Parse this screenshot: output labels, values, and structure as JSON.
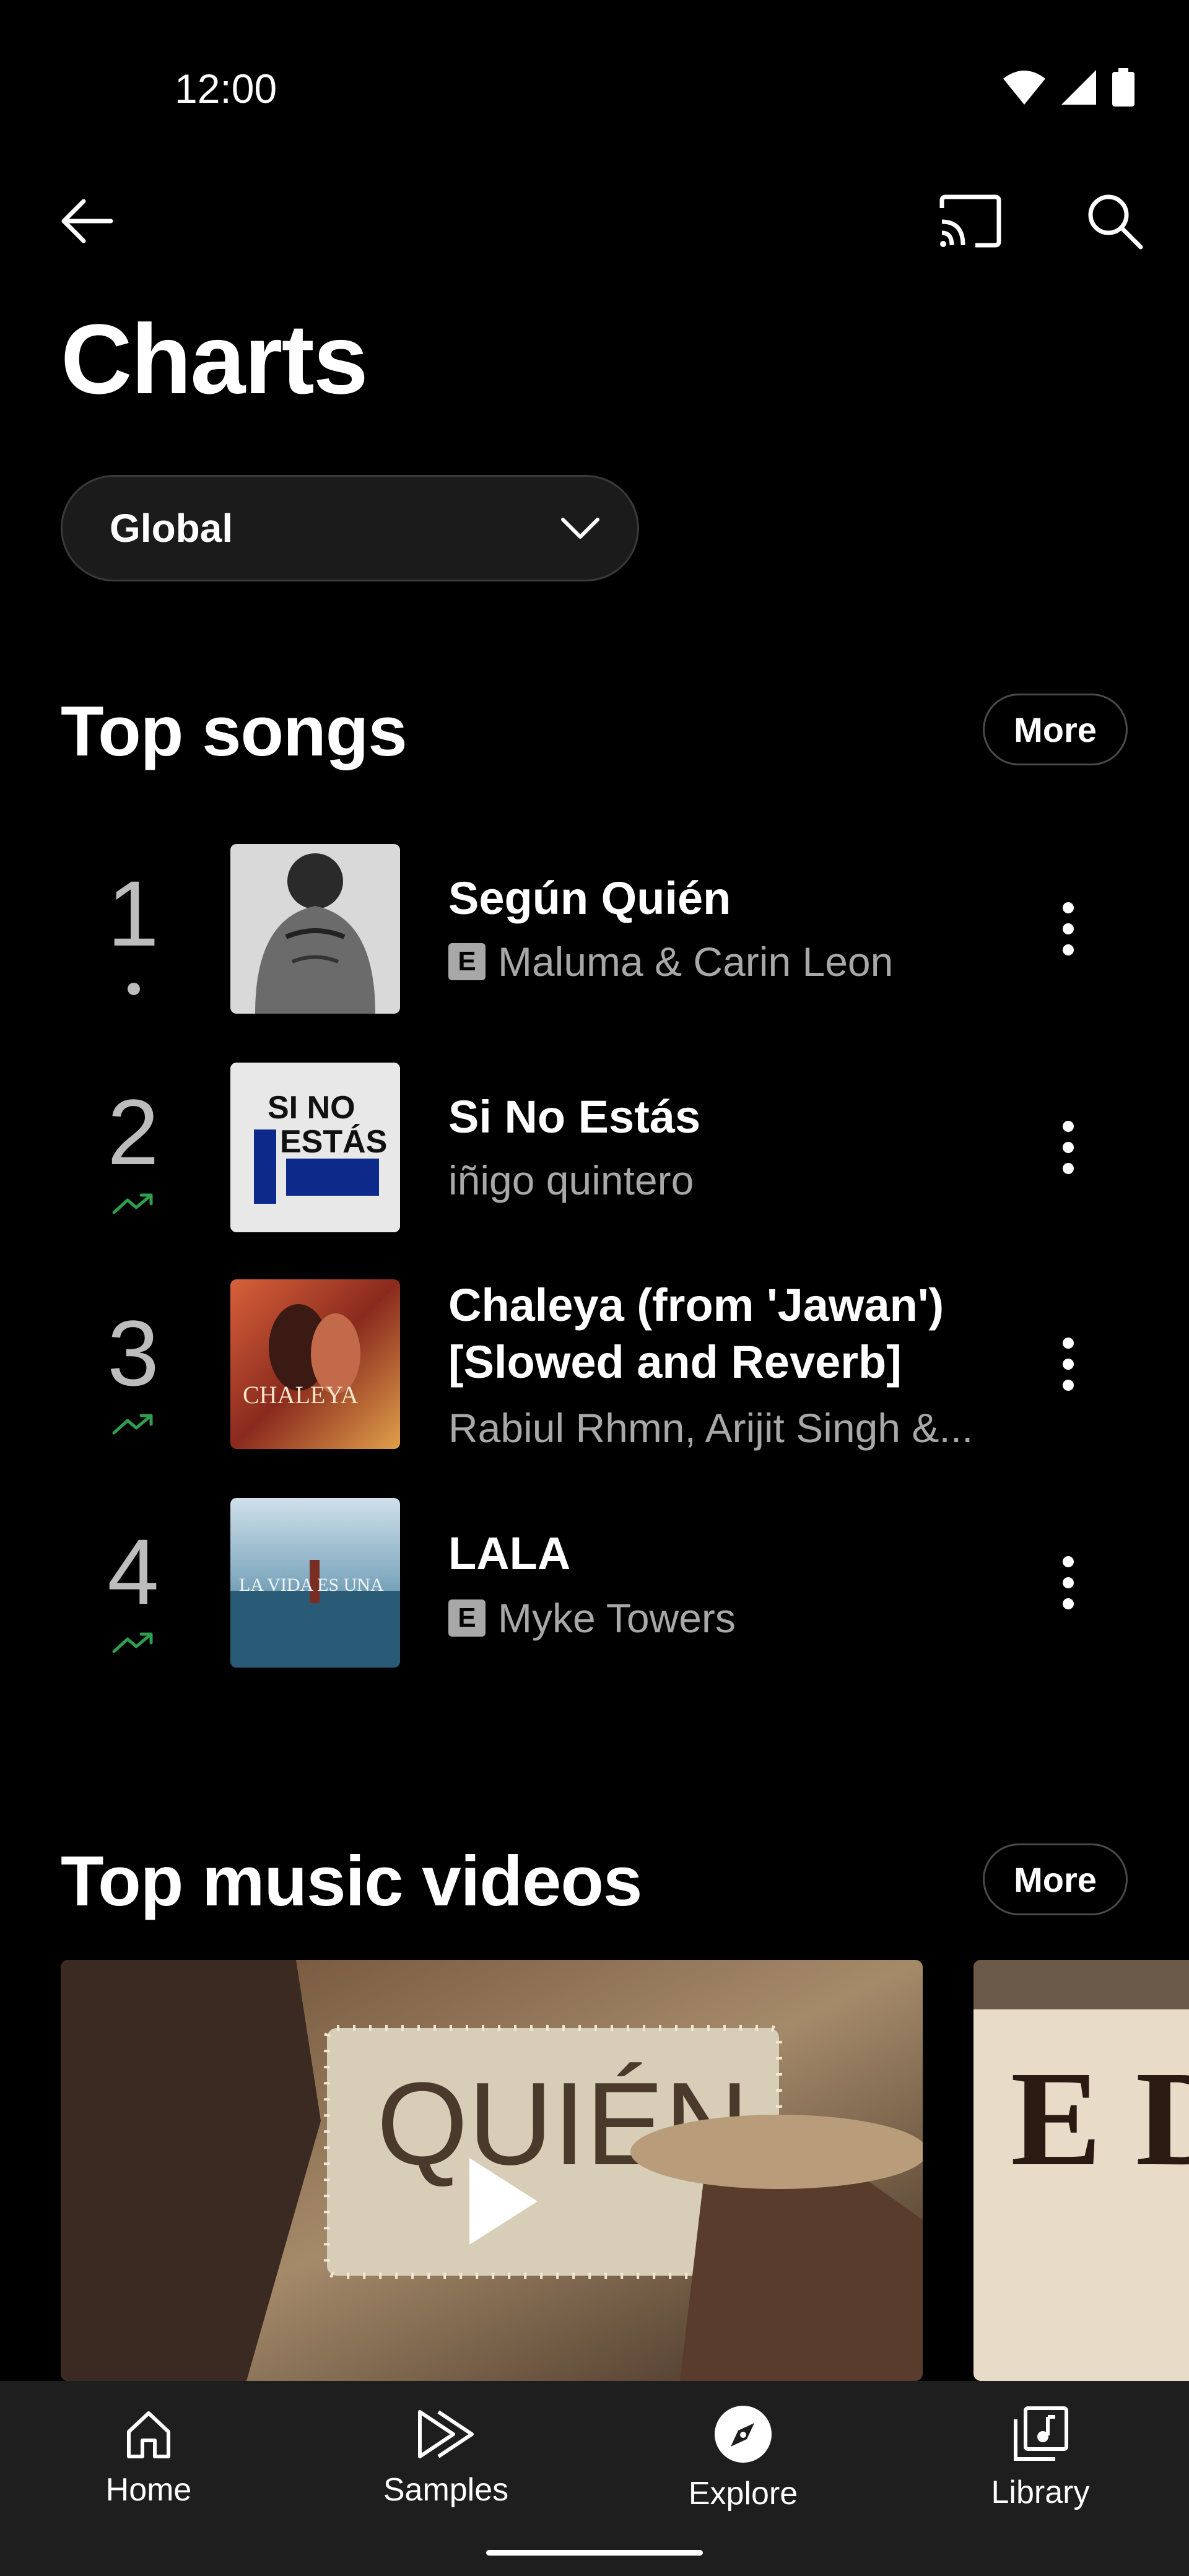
{
  "status_bar": {
    "time": "12:00"
  },
  "header": {
    "title": "Charts"
  },
  "country_selector": {
    "value": "Global"
  },
  "top_songs": {
    "title": "Top songs",
    "more_label": "More",
    "items": [
      {
        "rank": "1",
        "trend": "neutral",
        "title": "Según Quién",
        "artist": "Maluma & Carin Leon",
        "explicit": true,
        "thumb_text": ""
      },
      {
        "rank": "2",
        "trend": "up",
        "title": "Si No Estás",
        "artist": "iñigo quintero",
        "explicit": false,
        "thumb_text": "SI NO ESTÁS"
      },
      {
        "rank": "3",
        "trend": "up",
        "title": "Chaleya (from 'Jawan') [Slowed and Reverb]",
        "artist": "Rabiul Rhmn, Arijit Singh &...",
        "explicit": false,
        "thumb_text": "CHALEYA"
      },
      {
        "rank": "4",
        "trend": "up",
        "title": "LALA",
        "artist": "Myke Towers",
        "explicit": true,
        "thumb_text": "LA VIDA ES UNA"
      }
    ]
  },
  "top_videos": {
    "title": "Top music videos",
    "more_label": "More",
    "videos": [
      {
        "thumb_text": "QUIÉN"
      },
      {
        "thumb_text": "E De"
      }
    ]
  },
  "bottom_nav": {
    "items": [
      {
        "label": "Home",
        "icon": "home-icon",
        "active": false
      },
      {
        "label": "Samples",
        "icon": "samples-icon",
        "active": false
      },
      {
        "label": "Explore",
        "icon": "explore-icon",
        "active": true
      },
      {
        "label": "Library",
        "icon": "library-icon",
        "active": false
      }
    ]
  },
  "colors": {
    "background": "#000000",
    "nav_background": "#1e1e1e",
    "trend_up": "#2e9e4f",
    "secondary_text": "#a8a8a8"
  }
}
